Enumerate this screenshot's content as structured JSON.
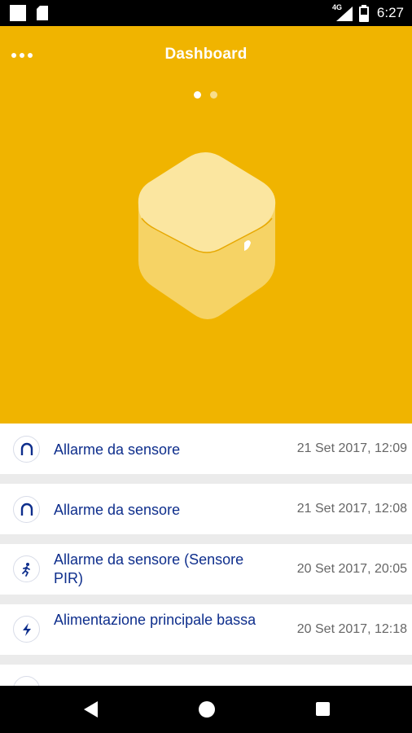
{
  "status_bar": {
    "network": "4G",
    "time": "6:27"
  },
  "header": {
    "title": "Dashboard",
    "pager": {
      "pages": 2,
      "active": 0
    },
    "colors": {
      "background": "#f0b400",
      "device_body": "#f7d66a",
      "device_top": "#fbe7a2"
    }
  },
  "events": [
    {
      "icon": "magnet-icon",
      "title": "Allarme da sensore",
      "date": "21 Set 2017, 12:09"
    },
    {
      "icon": "magnet-icon",
      "title": "Allarme da sensore",
      "date": "21 Set 2017, 12:08"
    },
    {
      "icon": "walking-person-icon",
      "title": "Allarme da sensore (Sensore PIR)",
      "date": "20 Set 2017, 20:05"
    },
    {
      "icon": "lightning-bolt-icon",
      "title": "Alimentazione principale bassa",
      "date": "20 Set 2017, 12:18"
    }
  ],
  "colors": {
    "accent_text": "#0e2e8c",
    "list_background": "#ebebeb"
  }
}
